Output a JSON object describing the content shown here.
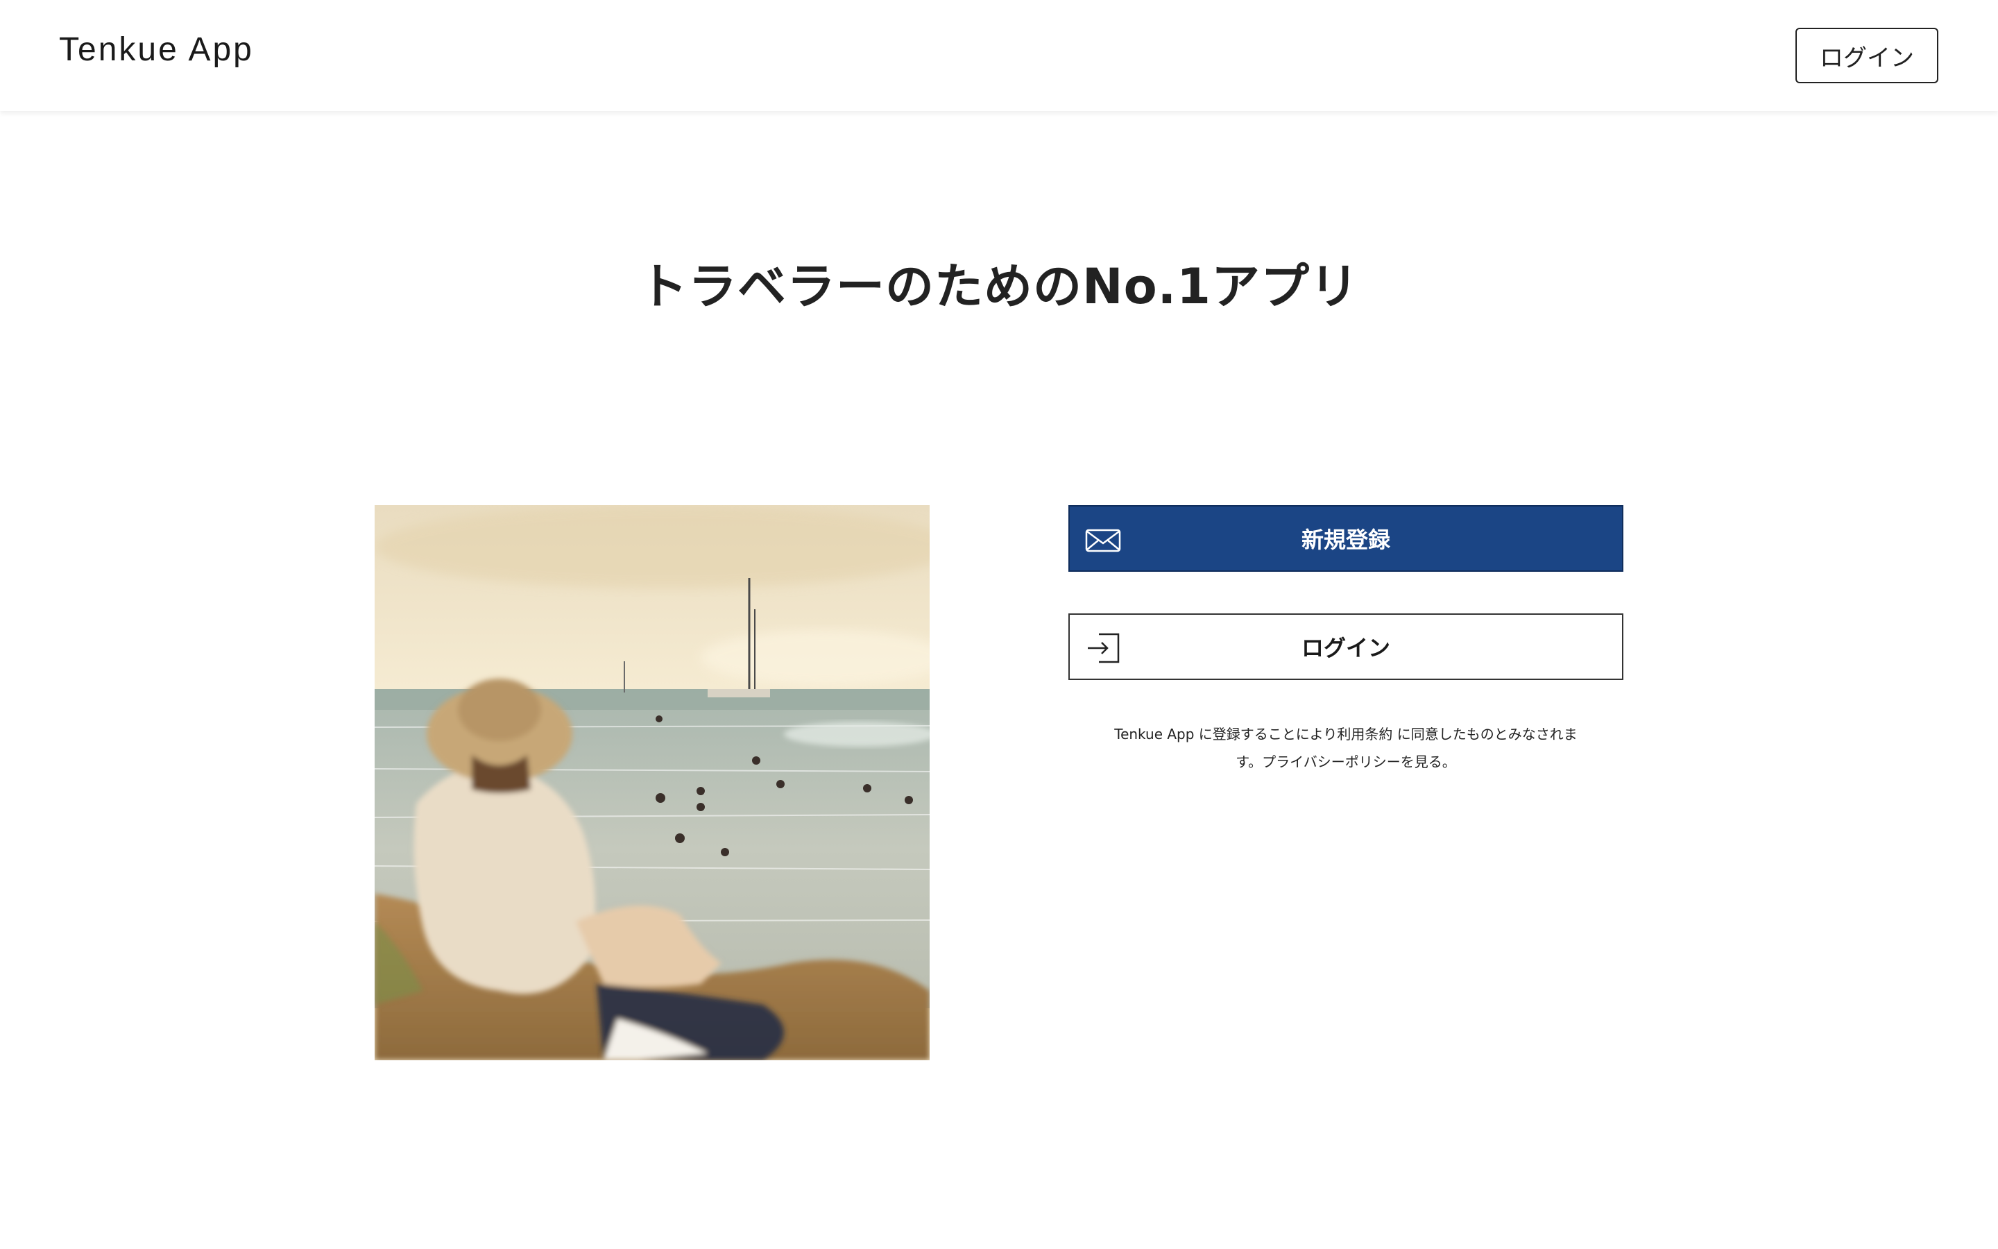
{
  "header": {
    "app_name": "Tenkue App",
    "login_label": "ログイン"
  },
  "hero": {
    "title": "トラベラーのためのNo.1アプリ"
  },
  "photo": {
    "alt": "beach photo"
  },
  "signup_button": {
    "label": "新規登録",
    "icon": "mail-icon"
  },
  "login_button": {
    "label": "ログイン",
    "icon": "login-icon"
  },
  "terms": {
    "text": "Tenkue App に登録することにより利用条約 に同意したものとみなされます。プライバシーポリシーを見る。"
  },
  "colors": {
    "primary": "#1b4585",
    "text": "#222222",
    "background": "#ffffff"
  }
}
